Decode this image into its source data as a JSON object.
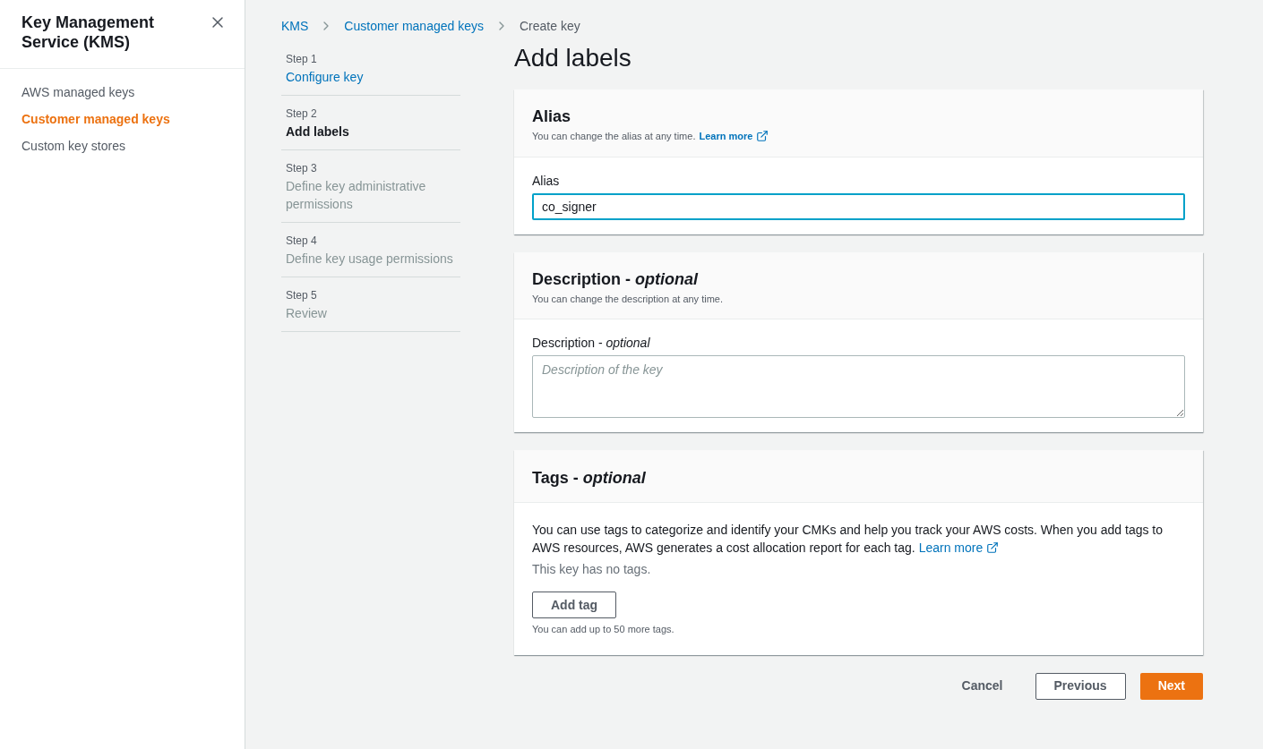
{
  "sidebar": {
    "title": "Key Management Service (KMS)",
    "items": [
      {
        "label": "AWS managed keys",
        "selected": false
      },
      {
        "label": "Customer managed keys",
        "selected": true
      },
      {
        "label": "Custom key stores",
        "selected": false
      }
    ]
  },
  "breadcrumb": [
    {
      "label": "KMS",
      "kind": "link"
    },
    {
      "label": "Customer managed keys",
      "kind": "link"
    },
    {
      "label": "Create key",
      "kind": "current"
    }
  ],
  "steps": [
    {
      "label": "Step 1",
      "title": "Configure key",
      "kind": "done"
    },
    {
      "label": "Step 2",
      "title": "Add labels",
      "kind": "current"
    },
    {
      "label": "Step 3",
      "title": "Define key administrative permissions",
      "kind": "pending"
    },
    {
      "label": "Step 4",
      "title": "Define key usage permissions",
      "kind": "pending"
    },
    {
      "label": "Step 5",
      "title": "Review",
      "kind": "pending"
    }
  ],
  "page_title": "Add labels",
  "alias": {
    "heading": "Alias",
    "description": "You can change the alias at any time.",
    "link": "Learn more",
    "field_label": "Alias",
    "value": "co_signer"
  },
  "description": {
    "heading": "Description - *optional*",
    "description": "You can change the description at any time.",
    "field_label": "Description - *optional*",
    "placeholder": "Description of the key"
  },
  "tags": {
    "heading": "Tags - *optional*",
    "text": "You can use tags to categorize and identify your CMKs and help you track your AWS costs. When you add tags to AWS resources, AWS generates a cost allocation report for each tag.",
    "link": "Learn more",
    "empty": "This key has no tags.",
    "button": "Add tag",
    "hint": "You can add up to 50 more tags."
  },
  "actions": {
    "cancel": "Cancel",
    "previous": "Previous",
    "next": "Next"
  }
}
